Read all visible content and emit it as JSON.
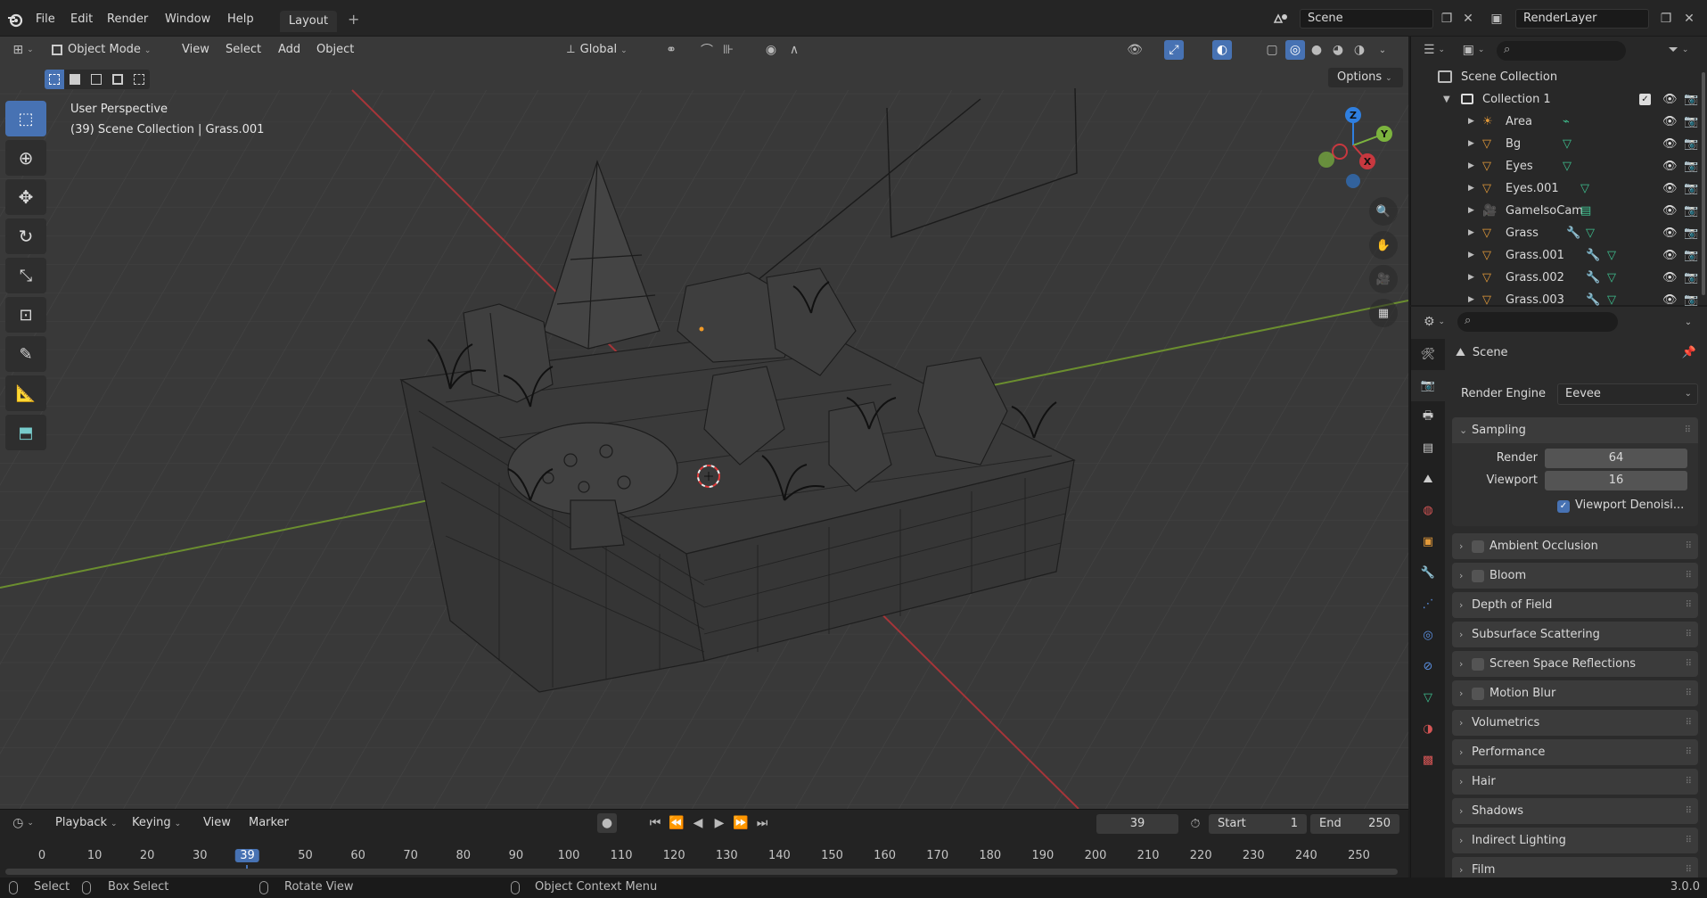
{
  "topbar": {
    "menus": [
      "File",
      "Edit",
      "Render",
      "Window",
      "Help"
    ],
    "workspace_tab": "Layout",
    "add_tab": "+",
    "scene": "Scene",
    "view_layer": "RenderLayer"
  },
  "viewport": {
    "mode": "Object Mode",
    "menus": [
      "View",
      "Select",
      "Add",
      "Object"
    ],
    "transform_orientation": "Global",
    "options_label": "Options",
    "overlay_title": "User Perspective",
    "overlay_subtitle": "(39) Scene Collection | Grass.001",
    "axes": {
      "z": "Z",
      "y": "Y",
      "x": "X"
    }
  },
  "timeline": {
    "menus": [
      "Playback",
      "Keying",
      "View",
      "Marker"
    ],
    "current_frame": "39",
    "start_label": "Start",
    "start_value": "1",
    "end_label": "End",
    "end_value": "250",
    "ticks": [
      "0",
      "10",
      "20",
      "30",
      "39",
      "50",
      "60",
      "70",
      "80",
      "90",
      "100",
      "110",
      "120",
      "130",
      "140",
      "150",
      "160",
      "170",
      "180",
      "190",
      "200",
      "210",
      "220",
      "230",
      "240",
      "250"
    ]
  },
  "statusbar": {
    "select": "Select",
    "box_select": "Box Select",
    "rotate_view": "Rotate View",
    "context_menu": "Object Context Menu",
    "version": "3.0.0"
  },
  "outliner": {
    "root": "Scene Collection",
    "collection": "Collection 1",
    "items": [
      {
        "name": "Area",
        "type": "light"
      },
      {
        "name": "Bg",
        "type": "mesh"
      },
      {
        "name": "Eyes",
        "type": "mesh"
      },
      {
        "name": "Eyes.001",
        "type": "mesh"
      },
      {
        "name": "GameIsoCam",
        "type": "camera"
      },
      {
        "name": "Grass",
        "type": "mesh"
      },
      {
        "name": "Grass.001",
        "type": "mesh"
      },
      {
        "name": "Grass.002",
        "type": "mesh"
      },
      {
        "name": "Grass.003",
        "type": "mesh"
      }
    ]
  },
  "properties": {
    "context": "Scene",
    "render_engine_label": "Render Engine",
    "render_engine_value": "Eevee",
    "sampling": {
      "title": "Sampling",
      "render_label": "Render",
      "render_value": "64",
      "viewport_label": "Viewport",
      "viewport_value": "16",
      "denoise_label": "Viewport Denoisi..."
    },
    "panels": [
      {
        "label": "Ambient Occlusion",
        "checkbox": true
      },
      {
        "label": "Bloom",
        "checkbox": true
      },
      {
        "label": "Depth of Field",
        "checkbox": false
      },
      {
        "label": "Subsurface Scattering",
        "checkbox": false
      },
      {
        "label": "Screen Space Reflections",
        "checkbox": true
      },
      {
        "label": "Motion Blur",
        "checkbox": true
      },
      {
        "label": "Volumetrics",
        "checkbox": false
      },
      {
        "label": "Performance",
        "checkbox": false
      },
      {
        "label": "Hair",
        "checkbox": false
      },
      {
        "label": "Shadows",
        "checkbox": false
      },
      {
        "label": "Indirect Lighting",
        "checkbox": false
      },
      {
        "label": "Film",
        "checkbox": false
      }
    ]
  },
  "colors": {
    "accent": "#4772b3",
    "axis_x": "#c8383f",
    "axis_y": "#7cb43e",
    "axis_z": "#2f7fe0"
  }
}
